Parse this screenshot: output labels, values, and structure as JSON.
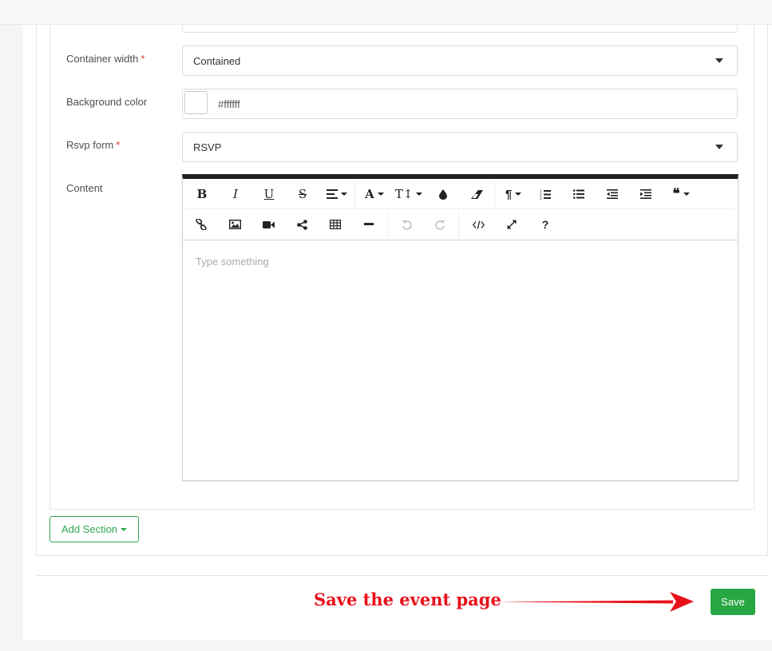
{
  "form": {
    "container_width": {
      "label": "Container width",
      "required_mark": "*",
      "value": "Contained"
    },
    "background_color": {
      "label": "Background color",
      "value": "#ffffff",
      "swatch_color": "#ffffff"
    },
    "rsvp_form": {
      "label": "Rsvp form",
      "required_mark": "*",
      "value": "RSVP"
    },
    "content": {
      "label": "Content",
      "placeholder": "Type something",
      "toolbar_row1": [
        "bold",
        "italic",
        "underline",
        "strikethrough",
        "align",
        "font-family",
        "font-size",
        "text-color",
        "clear-format",
        "paragraph",
        "ordered-list",
        "unordered-list",
        "outdent",
        "indent",
        "quote"
      ],
      "toolbar_row2": [
        "link",
        "image",
        "video",
        "share",
        "table",
        "horizontal-rule",
        "undo",
        "redo",
        "code-view",
        "fullscreen",
        "help"
      ]
    }
  },
  "actions": {
    "add_section_label": "Add Section",
    "save_label": "Save"
  },
  "annotation": {
    "text": "Save the event page",
    "color": "#e8111a"
  },
  "colors": {
    "accent_green": "#28a745",
    "editor_top_border": "#222222"
  }
}
